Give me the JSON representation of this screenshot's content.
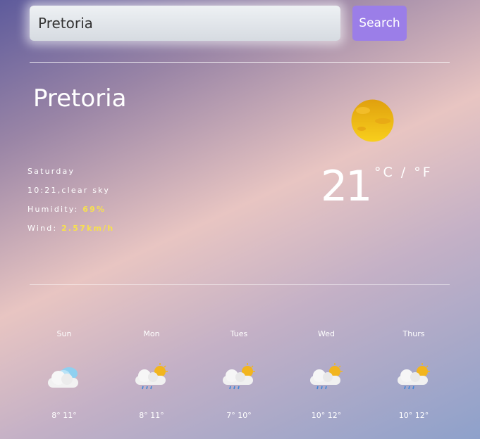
{
  "search": {
    "value": "Pretoria",
    "button_label": "Search"
  },
  "current": {
    "city": "Pretoria",
    "day": "Saturday",
    "time_desc": "10:21,clear sky",
    "humidity_label": "Humidity: ",
    "humidity_value": "69%",
    "wind_label": "Wind: ",
    "wind_value": "2.57km/h",
    "temperature": "21",
    "units": "°C / °F",
    "icon": "sun-icon"
  },
  "forecast": [
    {
      "day": "Sun",
      "temps": "8° 11°",
      "icon": "partly-cloudy-icon"
    },
    {
      "day": "Mon",
      "temps": "8° 11°",
      "icon": "rain-sun-icon"
    },
    {
      "day": "Tues",
      "temps": "7° 10°",
      "icon": "rain-sun-icon"
    },
    {
      "day": "Wed",
      "temps": "10° 12°",
      "icon": "rain-sun-icon"
    },
    {
      "day": "Thurs",
      "temps": "10° 12°",
      "icon": "rain-sun-icon"
    }
  ],
  "colors": {
    "accent": "#9b7ee8",
    "highlight": "#f7e04e",
    "sun": "#f0b51a"
  }
}
